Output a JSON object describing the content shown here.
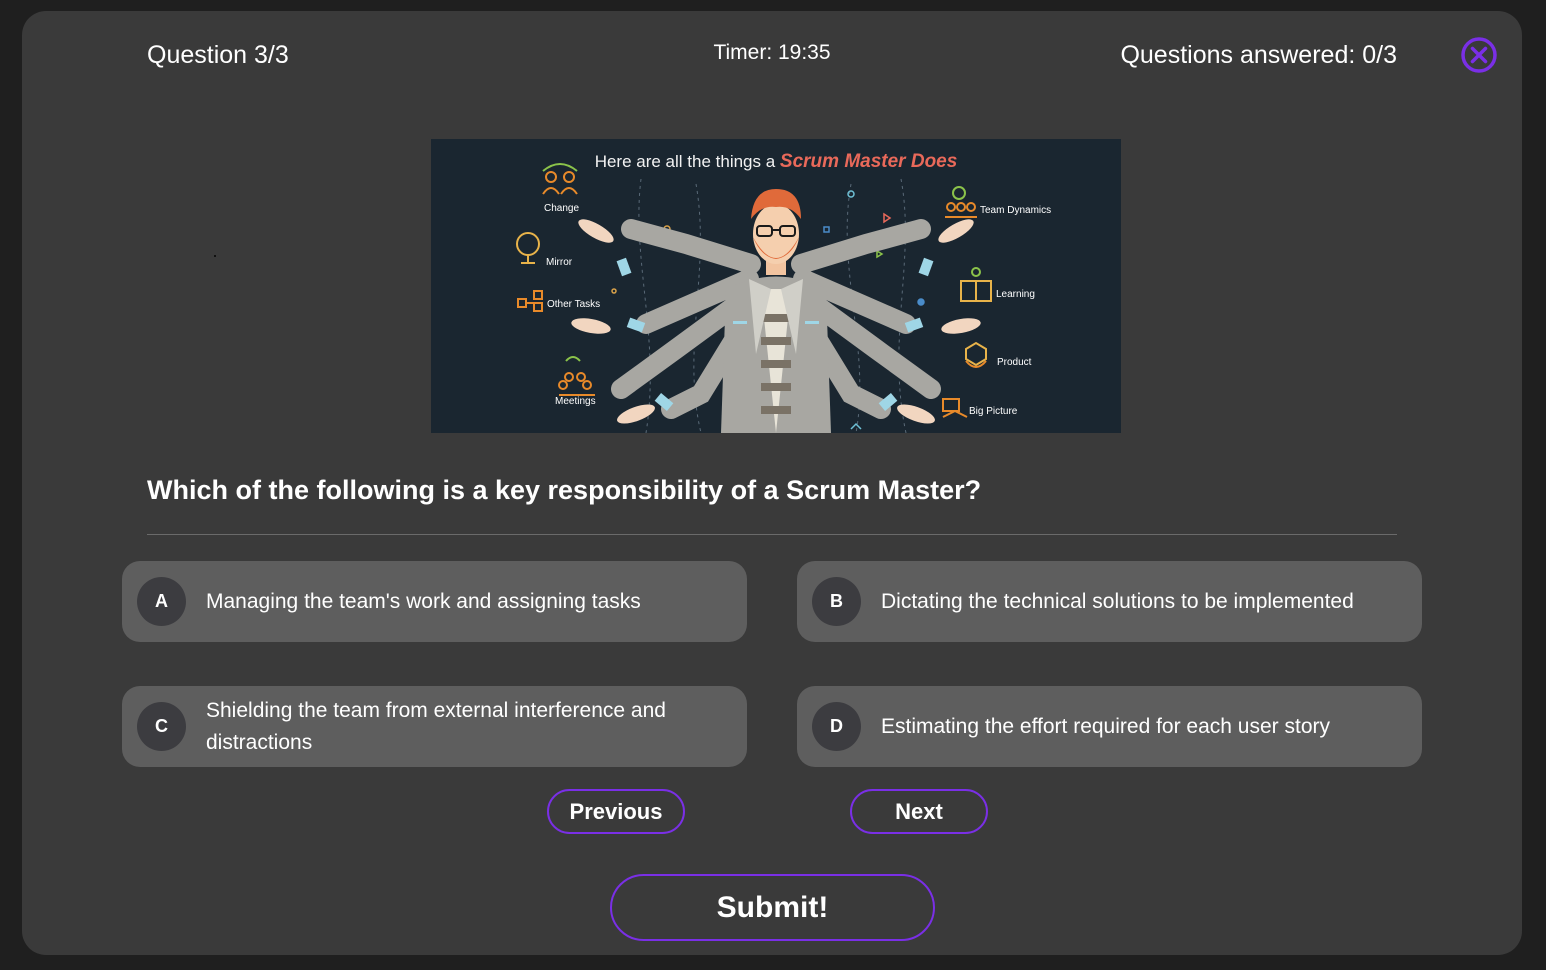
{
  "header": {
    "question_counter": "Question 3/3",
    "timer": "Timer: 19:35",
    "answered": "Questions answered: 0/3",
    "close_icon": "close-circle-icon",
    "accent_color": "#7a2fe6"
  },
  "illustration": {
    "title_prefix": "Here are all the things a ",
    "title_accent": "Scrum Master Does",
    "labels": {
      "change": "Change",
      "mirror": "Mirror",
      "other_tasks": "Other Tasks",
      "meetings": "Meetings",
      "team_dynamics": "Team Dynamics",
      "learning": "Learning",
      "product": "Product",
      "big_picture": "Big Picture"
    }
  },
  "question": {
    "text": "Which of the following is a key responsibility of a Scrum Master?"
  },
  "options": [
    {
      "letter": "A",
      "text": "Managing the team's work and assigning tasks"
    },
    {
      "letter": "B",
      "text": "Dictating the technical solutions to be implemented"
    },
    {
      "letter": "C",
      "text": "Shielding the team from external interference and distractions"
    },
    {
      "letter": "D",
      "text": "Estimating the effort required for each user story"
    }
  ],
  "navigation": {
    "previous": "Previous",
    "next": "Next",
    "submit": "Submit!"
  }
}
